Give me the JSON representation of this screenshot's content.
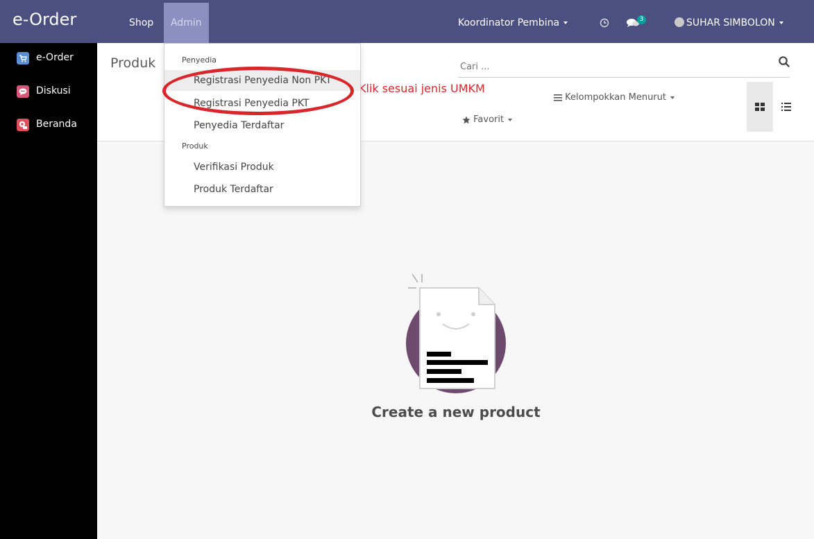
{
  "navbar": {
    "brand": "e-Order",
    "menu": [
      "Shop",
      "Admin"
    ],
    "company": "Koordinator Pembina",
    "chat_count": "3",
    "user": "SUHAR SIMBOLON",
    "icons": {
      "clock": "clock-icon",
      "chat": "chat-icon",
      "avatar": "avatar-icon"
    }
  },
  "sidebar": {
    "items": [
      {
        "label": "e-Order",
        "icon": "cart-icon",
        "color": "#5b8fd6"
      },
      {
        "label": "Diskusi",
        "icon": "chat-bubble-icon",
        "color": "#d9567b"
      },
      {
        "label": "Beranda",
        "icon": "home-icon",
        "color": "#e0505c"
      }
    ]
  },
  "control_panel": {
    "breadcrumb": "Produk",
    "search_placeholder": "Cari ...",
    "group_by": "Kelompokkan Menurut",
    "favorit": "Favorit"
  },
  "dropdown": {
    "section_provider": "Penyedia",
    "provider_items": [
      "Registrasi Penyedia Non PKT",
      "Registrasi Penyedia PKT",
      "Penyedia Terdaftar"
    ],
    "section_product": "Produk",
    "product_items": [
      "Verifikasi Produk",
      "Produk Terdaftar"
    ]
  },
  "annotation": "Klik sesuai jenis UMKM",
  "empty_state": {
    "title": "Create a new product"
  },
  "colors": {
    "navbar": "#4b5080",
    "annotation": "#d8262b",
    "badge": "#00a09d",
    "helper_circle": "#6e4a6e"
  }
}
